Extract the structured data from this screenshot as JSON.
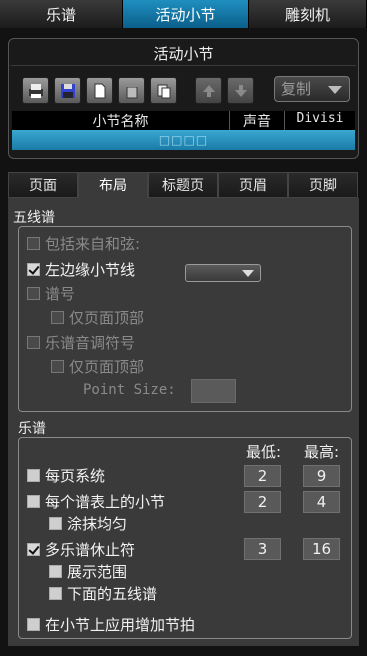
{
  "top_tabs": [
    "乐谱",
    "活动小节",
    "雕刻机"
  ],
  "panel": {
    "title": "活动小节",
    "copy_select": "复制",
    "columns": [
      "小节名称",
      "声音",
      "Divisi"
    ],
    "selected_row": "□□□□"
  },
  "sub_tabs": [
    "页面",
    "布局",
    "标题页",
    "页眉",
    "页脚"
  ],
  "staff_section": {
    "title": "五线谱",
    "include_chords": "包括来自和弦:",
    "left_barline": "左边缘小节线",
    "staff_number": "谱号",
    "staff_number_top_only": "仅页面顶部",
    "key_signature": "乐谱音调符号",
    "key_signature_top_only": "仅页面顶部",
    "point_size_label": "Point Size:"
  },
  "score_section": {
    "title": "乐谱",
    "min_label": "最低:",
    "max_label": "最高:",
    "systems_per_page": "每页系统",
    "systems_min": "2",
    "systems_max": "9",
    "measures_per_system": "每个谱表上的小节",
    "measures_min": "2",
    "measures_max": "4",
    "spread_evenly": "涂抹均匀",
    "multi_rest": "多乐谱休止符",
    "multi_rest_min": "3",
    "multi_rest_max": "16",
    "show_range": "展示范围",
    "below_staff": "下面的五线谱",
    "apply_pickup": "在小节上应用增加节拍"
  }
}
